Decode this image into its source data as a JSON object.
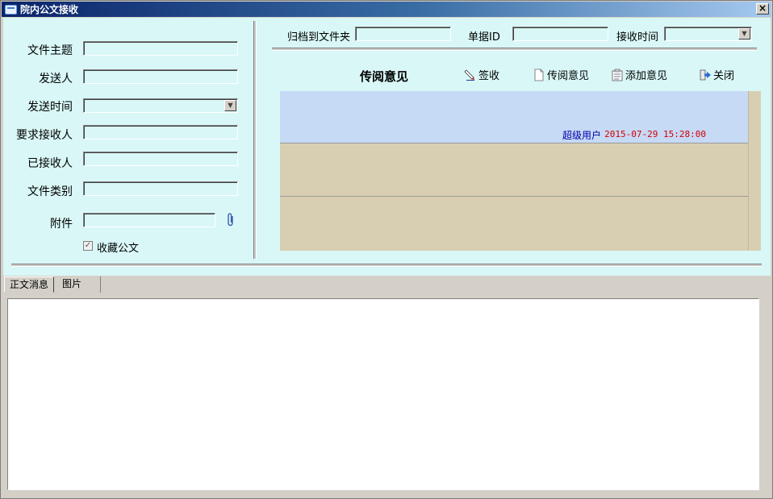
{
  "window": {
    "title": "院内公文接收",
    "close_label": "×"
  },
  "form": {
    "subject_label": "文件主题",
    "subject_value": "",
    "sender_label": "发送人",
    "sender_value": "",
    "send_time_label": "发送时间",
    "send_time_value": "",
    "required_recipients_label": "要求接收人",
    "required_recipients_value": "",
    "received_label": "已接收人",
    "received_value": "",
    "category_label": "文件类别",
    "category_value": "",
    "attachment_label": "附件",
    "attachment_value": "",
    "favorite_label": "收藏公文",
    "favorite_checked": true
  },
  "header": {
    "archive_label": "归档到文件夹",
    "archive_value": "",
    "doc_id_label": "单据ID",
    "doc_id_value": "",
    "receive_time_label": "接收时间",
    "receive_time_value": ""
  },
  "toolbar": {
    "title": "传阅意见",
    "sign_label": "签收",
    "circulate_label": "传阅意见",
    "add_opinion_label": "添加意见",
    "close_label": "关闭"
  },
  "opinions": [
    {
      "user": "超级用户",
      "time": "2015-07-29 15:28:00"
    },
    {
      "user": "",
      "time": ""
    },
    {
      "user": "",
      "time": ""
    }
  ],
  "tabs": [
    {
      "label": "正文消息",
      "active": true
    },
    {
      "label": "图片",
      "active": false
    }
  ],
  "colors": {
    "panel_bg": "#d9f7f7",
    "selected_row": "#c6d9f5",
    "row_bg": "#d8cfb3",
    "user_color": "#0000aa",
    "time_color": "#d40000"
  }
}
